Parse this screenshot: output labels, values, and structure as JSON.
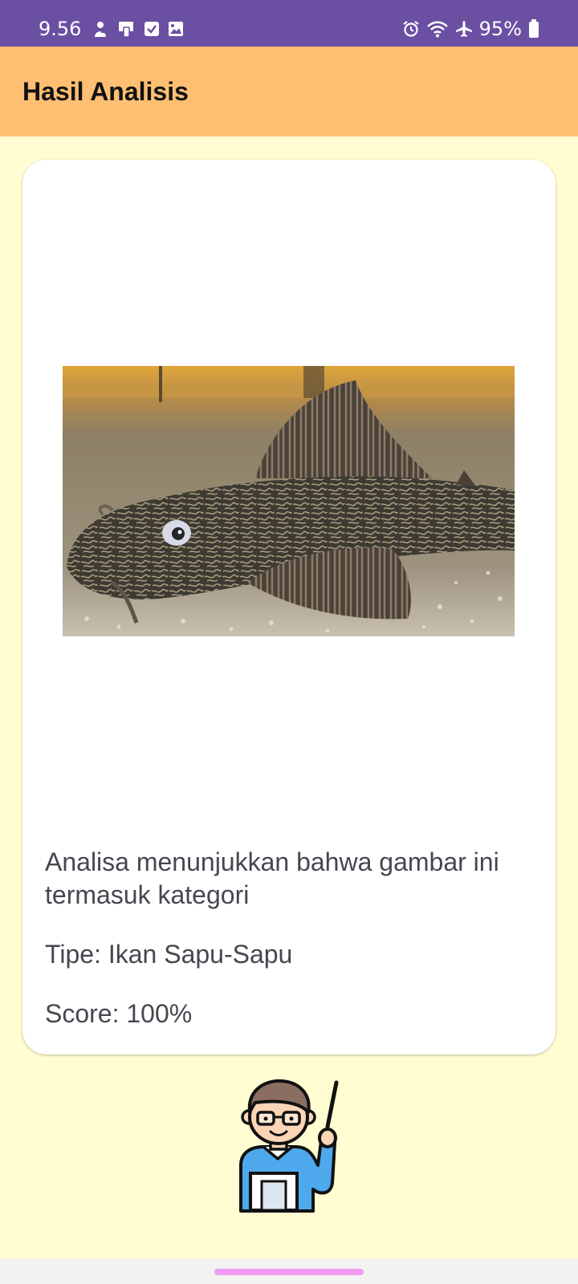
{
  "status_bar": {
    "time": "9.56",
    "battery_percent": "95%",
    "icons_left": [
      "person-icon",
      "phone-screen-icon",
      "check-box-icon",
      "gallery-icon"
    ],
    "icons_right": [
      "alarm-icon",
      "wifi-icon",
      "airplane-icon",
      "battery-icon"
    ]
  },
  "app_bar": {
    "title": "Hasil Analisis"
  },
  "result": {
    "image_subject": "ikan-sapu-sapu-photo",
    "description": "Analisa menunjukkan bahwa gambar ini termasuk kategori",
    "type": "Tipe: Ikan Sapu-Sapu",
    "score": "Score: 100%"
  },
  "illustration": {
    "icon": "teacher-pointer-icon"
  },
  "colors": {
    "status_bar": "#6a4fa3",
    "app_bar": "#ffbf72",
    "background": "#fffdd1",
    "card": "#ffffff",
    "text": "#49454f",
    "home_handle": "#f29bf0"
  }
}
